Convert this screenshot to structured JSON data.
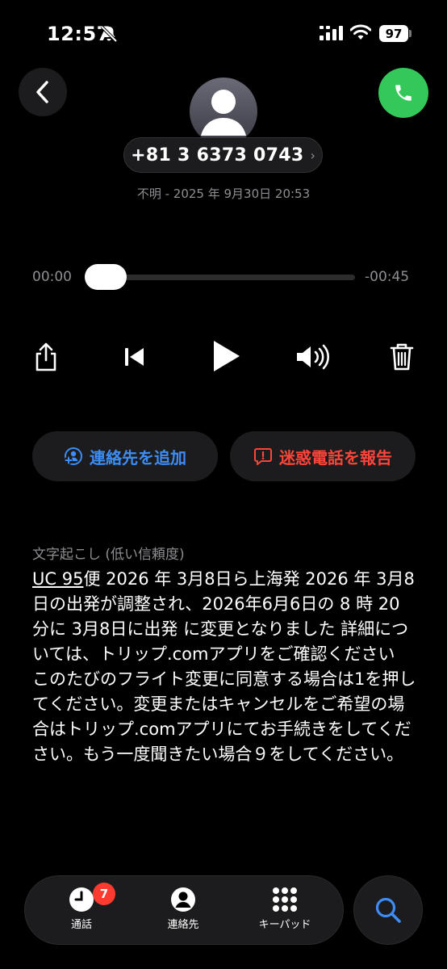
{
  "status_bar": {
    "time": "12:57",
    "battery": "97"
  },
  "header": {
    "phone_number": "+81 3 6373 0743",
    "chevron": "›",
    "subtitle": "不明 - 2025 年 9月30日 20:53"
  },
  "player": {
    "elapsed": "00:00",
    "remaining": "-00:45",
    "progress": 0
  },
  "actions": {
    "add_contact": "連絡先を追加",
    "report_spam": "迷惑電話を報告"
  },
  "transcript": {
    "label": "文字起こし (低い信頼度)",
    "lead": "UC 95",
    "text": "便 2026 年 3月8日ら上海発 2026 年 3月8日の出発が調整され、2026年6月6日の 8 時 20 分に 3月8日に出発 に変更となりました 詳細については、トリップ.comアプリをご確認ください このたびのフライト変更に同意する場合は1を押してください。変更またはキャンセルをご希望の場合はトリップ.comアプリにてお手続きをしてください。もう一度聞きたい場合９をしてください。"
  },
  "tabs": {
    "calls": "通話",
    "calls_badge": "7",
    "contacts": "連絡先",
    "keypad": "キーパッド"
  },
  "colors": {
    "accent_blue": "#3e8cf5",
    "danger_red": "#ff453a",
    "call_green": "#34c759"
  }
}
